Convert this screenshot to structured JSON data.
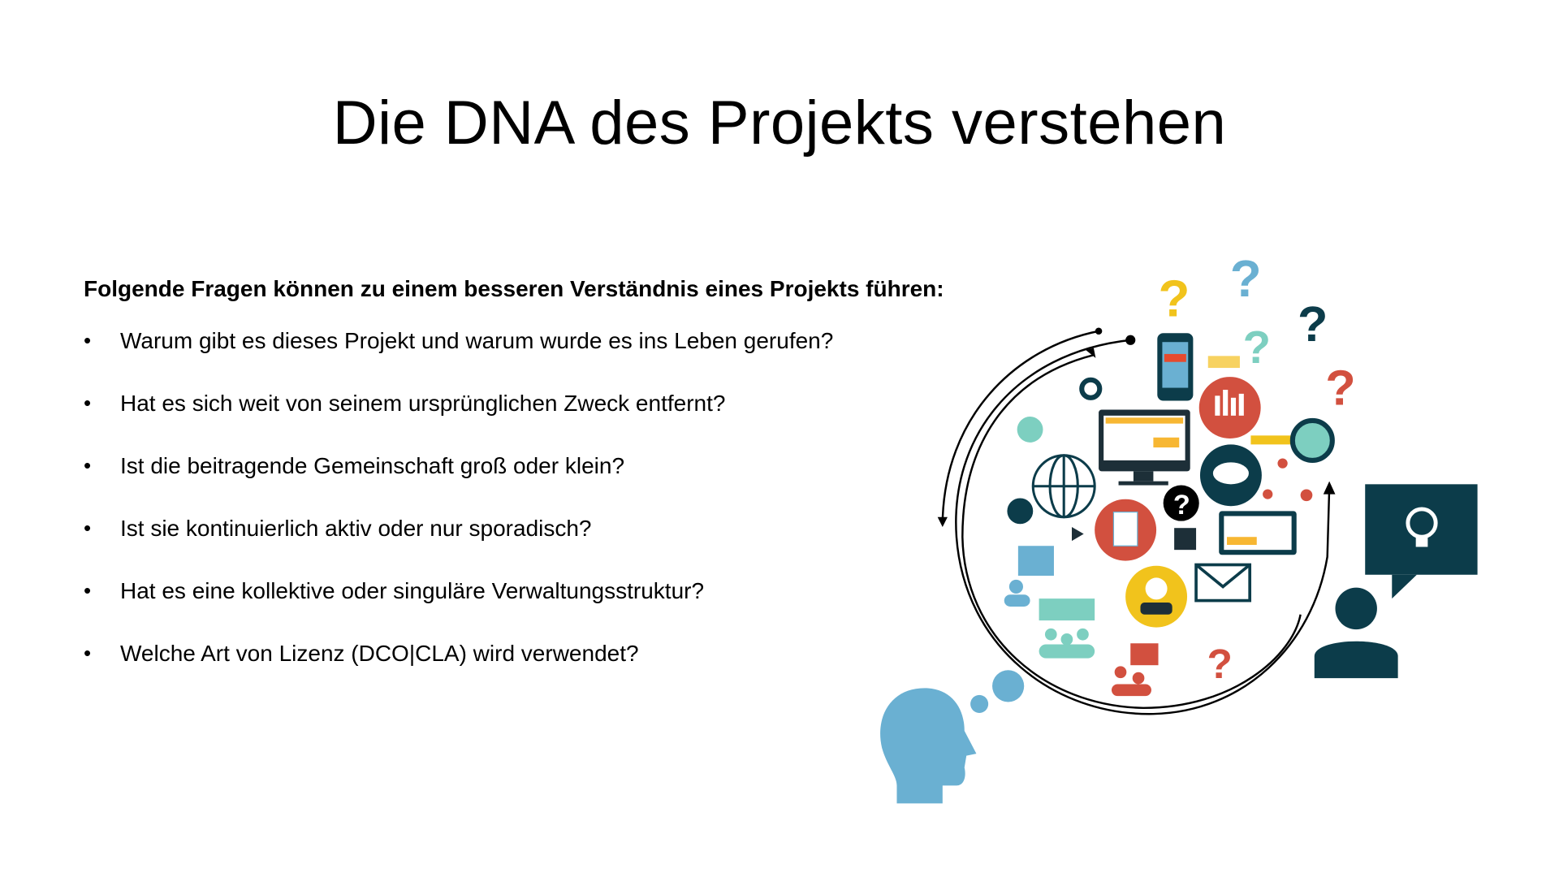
{
  "slide": {
    "title": "Die DNA des Projekts verstehen",
    "intro": "Folgende Fragen können zu einem besseren Verständnis eines Projekts führen:",
    "bullets": [
      "Warum gibt es dieses Projekt und warum wurde es ins Leben gerufen?",
      "Hat es sich weit von seinem ursprünglichen Zweck entfernt?",
      "Ist die beitragende Gemeinschaft groß oder klein?",
      "Ist sie kontinuierlich aktiv oder nur sporadisch?",
      "Hat es eine kollektive oder singuläre Verwaltungsstruktur?",
      "Welche Art von Lizenz (DCO|CLA) wird verwendet?"
    ],
    "bullet_char": "•",
    "illustration": {
      "q": "?"
    }
  },
  "colors": {
    "teal": "#7dcfc0",
    "blue": "#6ab0d2",
    "dark": "#0c3c4a",
    "red": "#d2503f",
    "yellow": "#f1c31c"
  }
}
